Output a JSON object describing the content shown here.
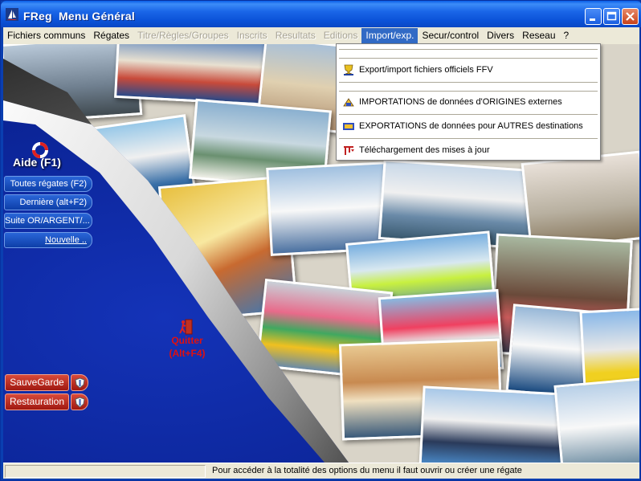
{
  "window": {
    "title": "FReg  Menu Général"
  },
  "menu": [
    {
      "label": "Fichiers communs",
      "state": "enabled"
    },
    {
      "label": "Régates",
      "state": "enabled"
    },
    {
      "label": "Titre/Règles/Groupes",
      "state": "disabled"
    },
    {
      "label": "Inscrits",
      "state": "disabled"
    },
    {
      "label": "Resultats",
      "state": "disabled"
    },
    {
      "label": "Editions",
      "state": "disabled"
    },
    {
      "label": "Import/exp.",
      "state": "active"
    },
    {
      "label": "Secur/control",
      "state": "enabled"
    },
    {
      "label": "Divers",
      "state": "enabled"
    },
    {
      "label": "Reseau",
      "state": "enabled"
    },
    {
      "label": "?",
      "state": "enabled"
    }
  ],
  "dropdown": {
    "items": [
      {
        "label": "Export/import fichiers officiels FFV",
        "icon": "trophy-icon"
      },
      {
        "label": "IMPORTATIONS de données d'ORIGINES externes",
        "icon": "import-icon"
      },
      {
        "label": "EXPORTATIONS de données pour AUTRES destinations",
        "icon": "export-icon"
      },
      {
        "label": "Téléchargement des mises à jour",
        "icon": "download-icon"
      }
    ]
  },
  "help": {
    "label": "Aide  (F1)"
  },
  "nav": {
    "all_regattas": "Toutes régates (F2)",
    "last": "Dernière  (alt+F2)",
    "suite": "Suite OR/ARGENT/...",
    "new": "Nouvelle .."
  },
  "quit": {
    "line1": "Quitter",
    "line2": "(Alt+F4)"
  },
  "backup": {
    "save": "SauveGarde",
    "restore": "Restauration"
  },
  "status": {
    "text": "Pour accéder à la totalité des options du menu il faut ouvrir ou créer une régate"
  },
  "colors": {
    "titlebar": "#0a5ee8",
    "menu_active": "#316ac5",
    "panel": "#0b2496",
    "quit": "#e01010"
  }
}
